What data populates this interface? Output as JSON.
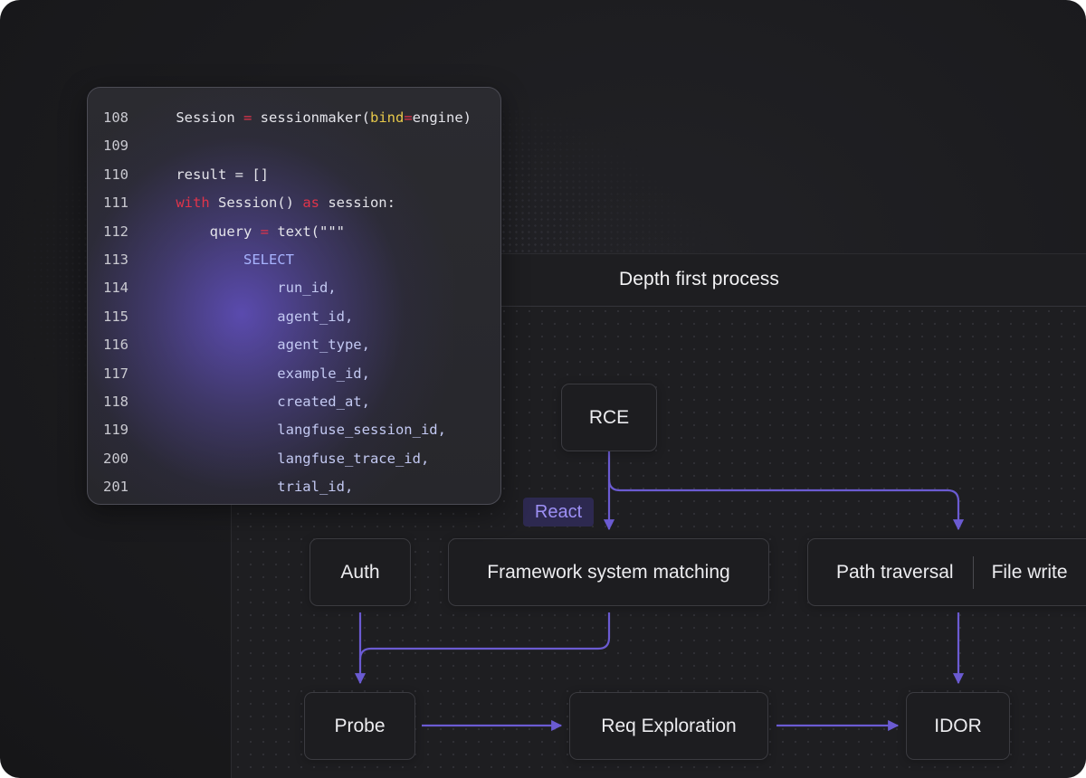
{
  "diagram": {
    "title": "Depth first process",
    "nodes": {
      "rce": "RCE",
      "auth": "Auth",
      "framework": "Framework system matching",
      "path_traversal": "Path traversal",
      "file_write": "File write",
      "probe": "Probe",
      "req_exploration": "Req Exploration",
      "idor": "IDOR"
    },
    "tag": "React",
    "edges": [
      {
        "from": "rce",
        "to": "framework"
      },
      {
        "from": "rce",
        "to": "path_traversal"
      },
      {
        "from": "auth",
        "to": "probe"
      },
      {
        "from": "framework",
        "to": "probe"
      },
      {
        "from": "path_traversal",
        "to": "idor"
      },
      {
        "from": "probe",
        "to": "req_exploration"
      },
      {
        "from": "req_exploration",
        "to": "idor"
      }
    ],
    "colors": {
      "edge": "#6b5bd2",
      "tag_text": "#9d90f5",
      "tag_bg": "#2d2950"
    }
  },
  "code": {
    "lines": [
      {
        "num": "108",
        "tokens": [
          {
            "t": "    Session ",
            "c": "default"
          },
          {
            "t": "=",
            "c": "keyword"
          },
          {
            "t": " sessionmaker(",
            "c": "default"
          },
          {
            "t": "bind",
            "c": "param"
          },
          {
            "t": "=",
            "c": "keyword"
          },
          {
            "t": "engine)",
            "c": "default"
          }
        ]
      },
      {
        "num": "109",
        "tokens": []
      },
      {
        "num": "110",
        "tokens": [
          {
            "t": "    result = []",
            "c": "default"
          }
        ]
      },
      {
        "num": "111",
        "tokens": [
          {
            "t": "    ",
            "c": "default"
          },
          {
            "t": "with",
            "c": "keyword"
          },
          {
            "t": " Session() ",
            "c": "default"
          },
          {
            "t": "as",
            "c": "keyword"
          },
          {
            "t": " session:",
            "c": "default"
          }
        ]
      },
      {
        "num": "112",
        "tokens": [
          {
            "t": "        query ",
            "c": "default"
          },
          {
            "t": "=",
            "c": "keyword"
          },
          {
            "t": " text(\"\"\"",
            "c": "default"
          }
        ]
      },
      {
        "num": "113",
        "tokens": [
          {
            "t": "            SELECT",
            "c": "string"
          }
        ]
      },
      {
        "num": "114",
        "tokens": [
          {
            "t": "                run_id,",
            "c": "ident"
          }
        ]
      },
      {
        "num": "115",
        "tokens": [
          {
            "t": "                agent_id,",
            "c": "ident"
          }
        ]
      },
      {
        "num": "116",
        "tokens": [
          {
            "t": "                agent_type,",
            "c": "ident"
          }
        ]
      },
      {
        "num": "117",
        "tokens": [
          {
            "t": "                example_id,",
            "c": "ident"
          }
        ]
      },
      {
        "num": "118",
        "tokens": [
          {
            "t": "                created_at,",
            "c": "ident"
          }
        ]
      },
      {
        "num": "119",
        "tokens": [
          {
            "t": "                langfuse_session_id,",
            "c": "ident"
          }
        ]
      },
      {
        "num": "200",
        "tokens": [
          {
            "t": "                langfuse_trace_id,",
            "c": "ident"
          }
        ]
      },
      {
        "num": "201",
        "tokens": [
          {
            "t": "                trial_id,",
            "c": "ident"
          }
        ]
      }
    ]
  }
}
